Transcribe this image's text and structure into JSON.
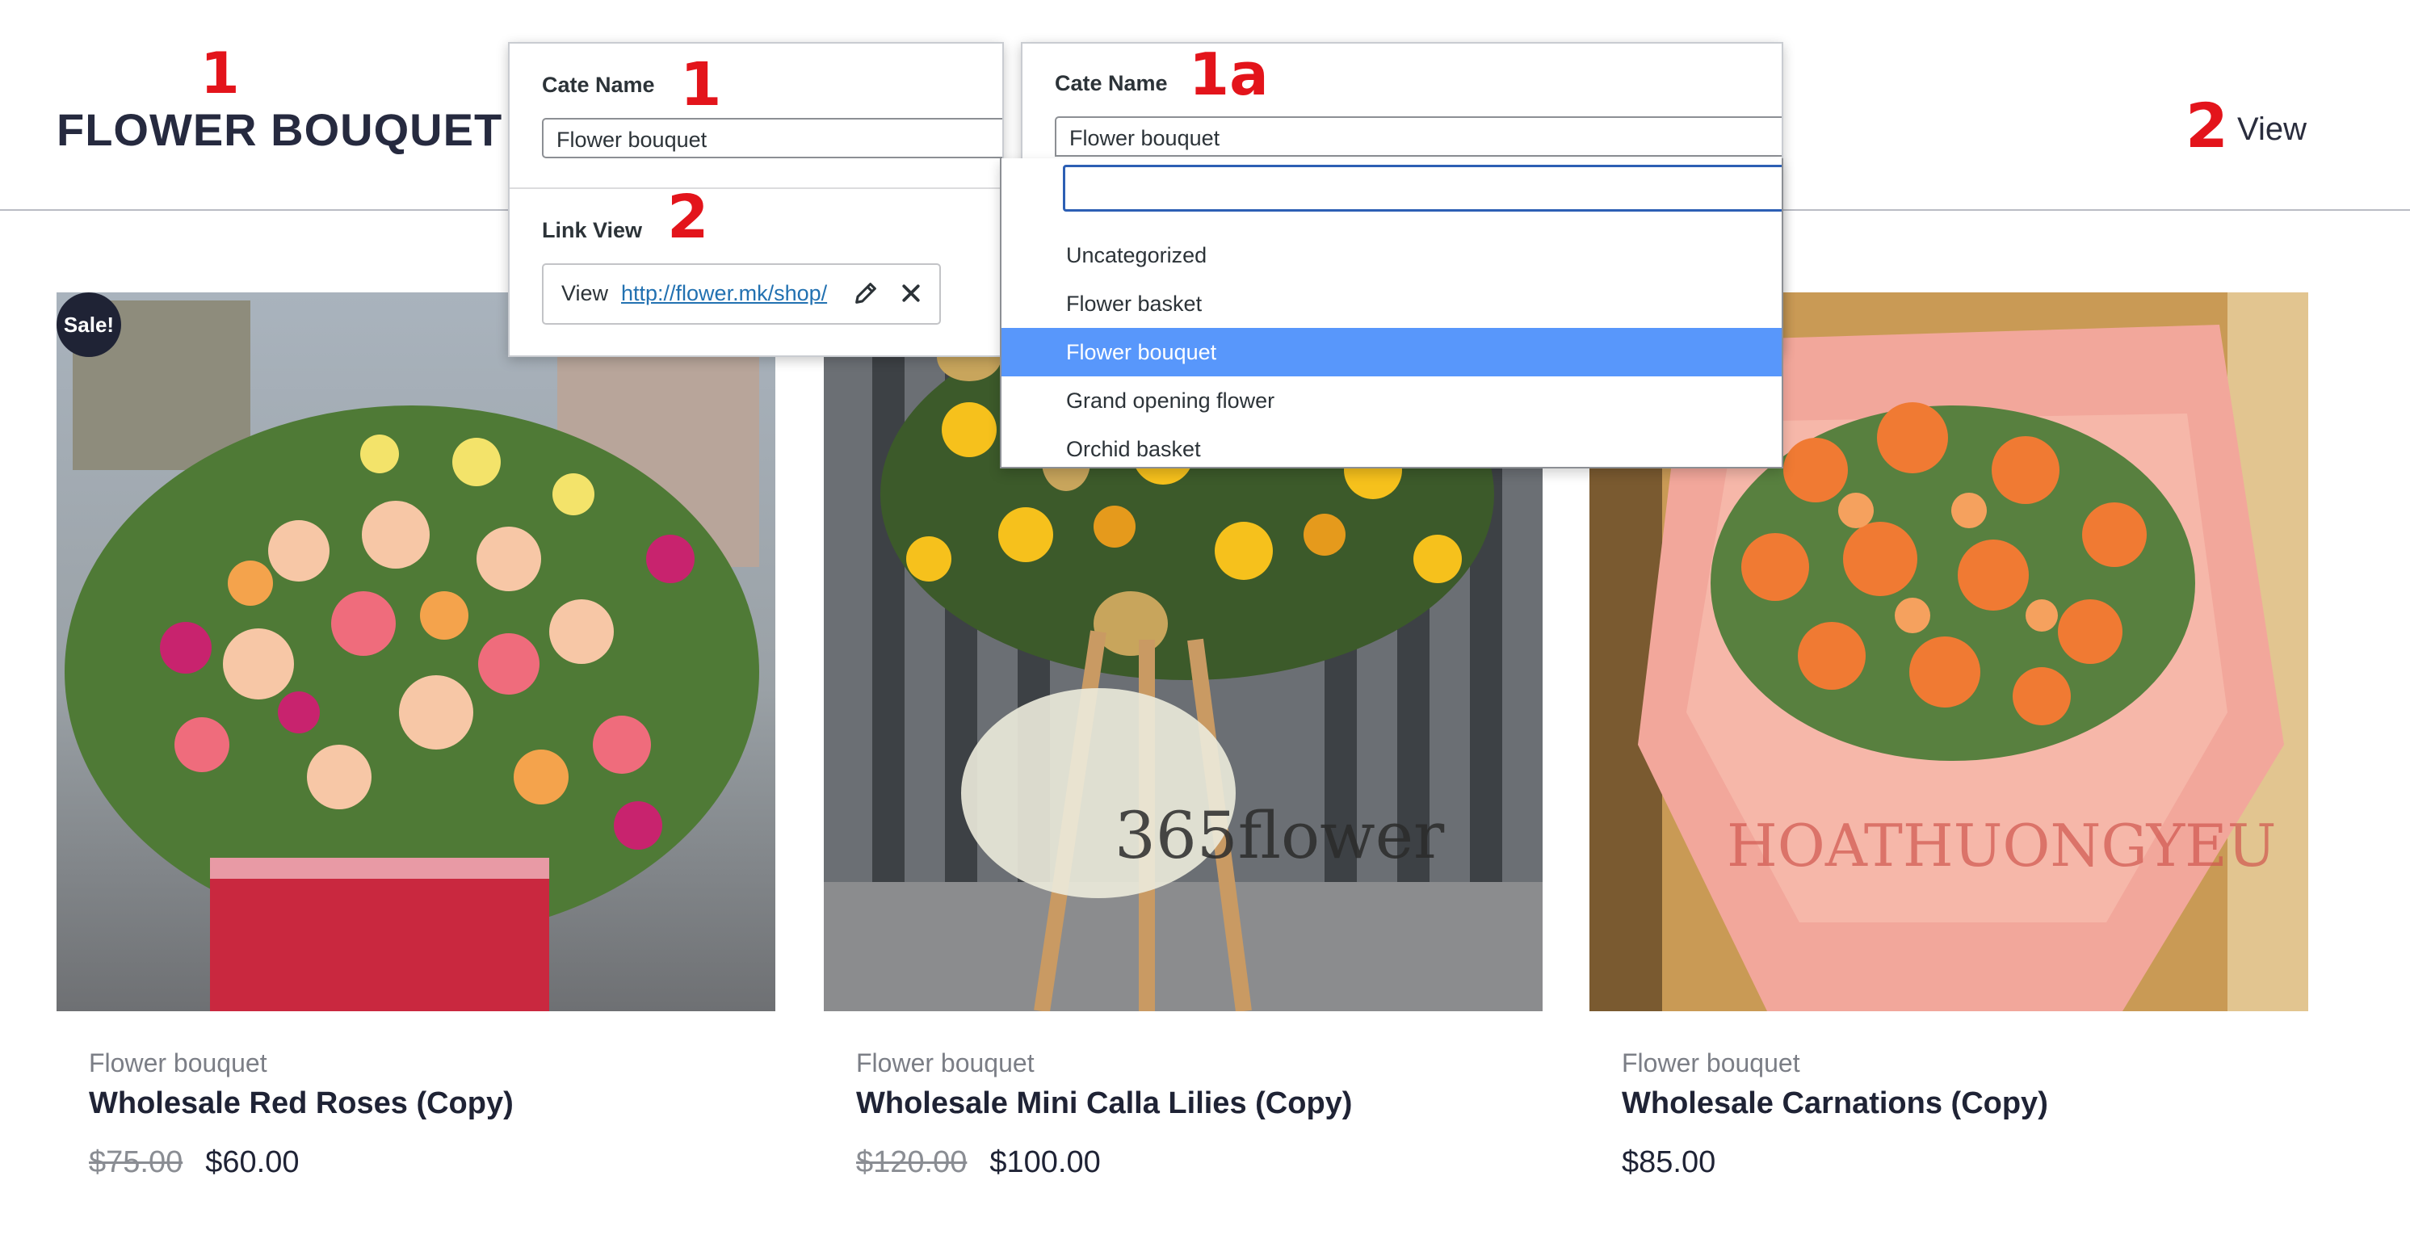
{
  "header": {
    "title": "FLOWER BOUQUET",
    "view_label": "View",
    "marker_title": "1",
    "marker_view": "2"
  },
  "products": [
    {
      "category": "Flower bouquet",
      "name": "Wholesale Red Roses (Copy)",
      "old_price": "$75.00",
      "price": "$60.00",
      "badge": "Sale!"
    },
    {
      "category": "Flower bouquet",
      "name": "Wholesale Mini Calla Lilies (Copy)",
      "old_price": "$120.00",
      "price": "$100.00"
    },
    {
      "category": "Flower bouquet",
      "name": "Wholesale Carnations (Copy)",
      "old_price": "",
      "price": "$85.00"
    }
  ],
  "popup_edit": {
    "cate_label": "Cate Name",
    "cate_value": "Flower bouquet",
    "link_label": "Link View",
    "link_prefix": "View",
    "link_url": "http://flower.mk/shop/",
    "marker_cate": "1",
    "marker_link": "2"
  },
  "popup_select": {
    "cate_label": "Cate Name",
    "selected_value": "Flower bouquet",
    "search_value": "",
    "marker": "1a",
    "options": [
      "Uncategorized",
      "Flower basket",
      "Flower bouquet",
      "Grand opening flower",
      "Orchid basket"
    ],
    "highlighted_index": 2,
    "highlight_color": "#5897fb"
  },
  "image_watermarks": [
    "365flower",
    "HOATHUONGYEU"
  ],
  "colors": {
    "accent_red": "#e3141b",
    "text_dark": "#1f2335",
    "link_blue": "#2271b1"
  }
}
